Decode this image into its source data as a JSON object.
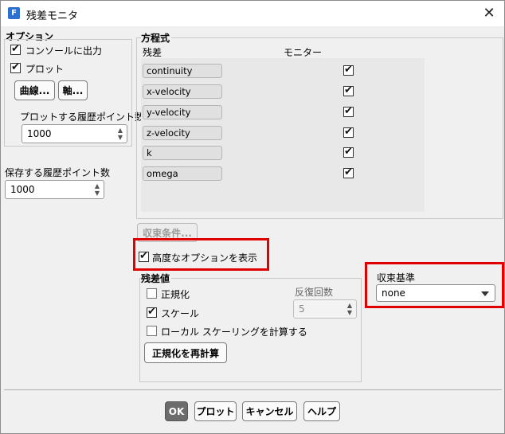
{
  "window": {
    "title": "残差モニタ"
  },
  "options": {
    "heading": "オプション",
    "print_console": "コンソールに出力",
    "plot": "プロット",
    "curves_button": "曲線...",
    "axes_button": "軸...",
    "plot_history_label": "プロットする履歴ポイント数",
    "plot_history_value": "1000",
    "store_history_label": "保存する履歴ポイント数",
    "store_history_value": "1000"
  },
  "equations": {
    "heading": "方程式",
    "col_residual": "残差",
    "col_monitor": "モニター",
    "rows": [
      {
        "name": "continuity",
        "monitor": true
      },
      {
        "name": "x-velocity",
        "monitor": true
      },
      {
        "name": "y-velocity",
        "monitor": true
      },
      {
        "name": "z-velocity",
        "monitor": true
      },
      {
        "name": "k",
        "monitor": true
      },
      {
        "name": "omega",
        "monitor": true
      }
    ]
  },
  "convergence_conditions_button": "収束条件...",
  "show_advanced": "高度なオプションを表示",
  "residual_values": {
    "heading": "残差値",
    "normalize": "正規化",
    "scale": "スケール",
    "local_scaling": "ローカル スケーリングを計算する",
    "iterations_label": "反復回数",
    "iterations_value": "5",
    "renormalize_button": "正規化を再計算"
  },
  "convergence_criterion": {
    "label": "収束基準",
    "value": "none"
  },
  "buttons": {
    "ok": "OK",
    "plot": "プロット",
    "cancel": "キャンセル",
    "help": "ヘルプ"
  }
}
